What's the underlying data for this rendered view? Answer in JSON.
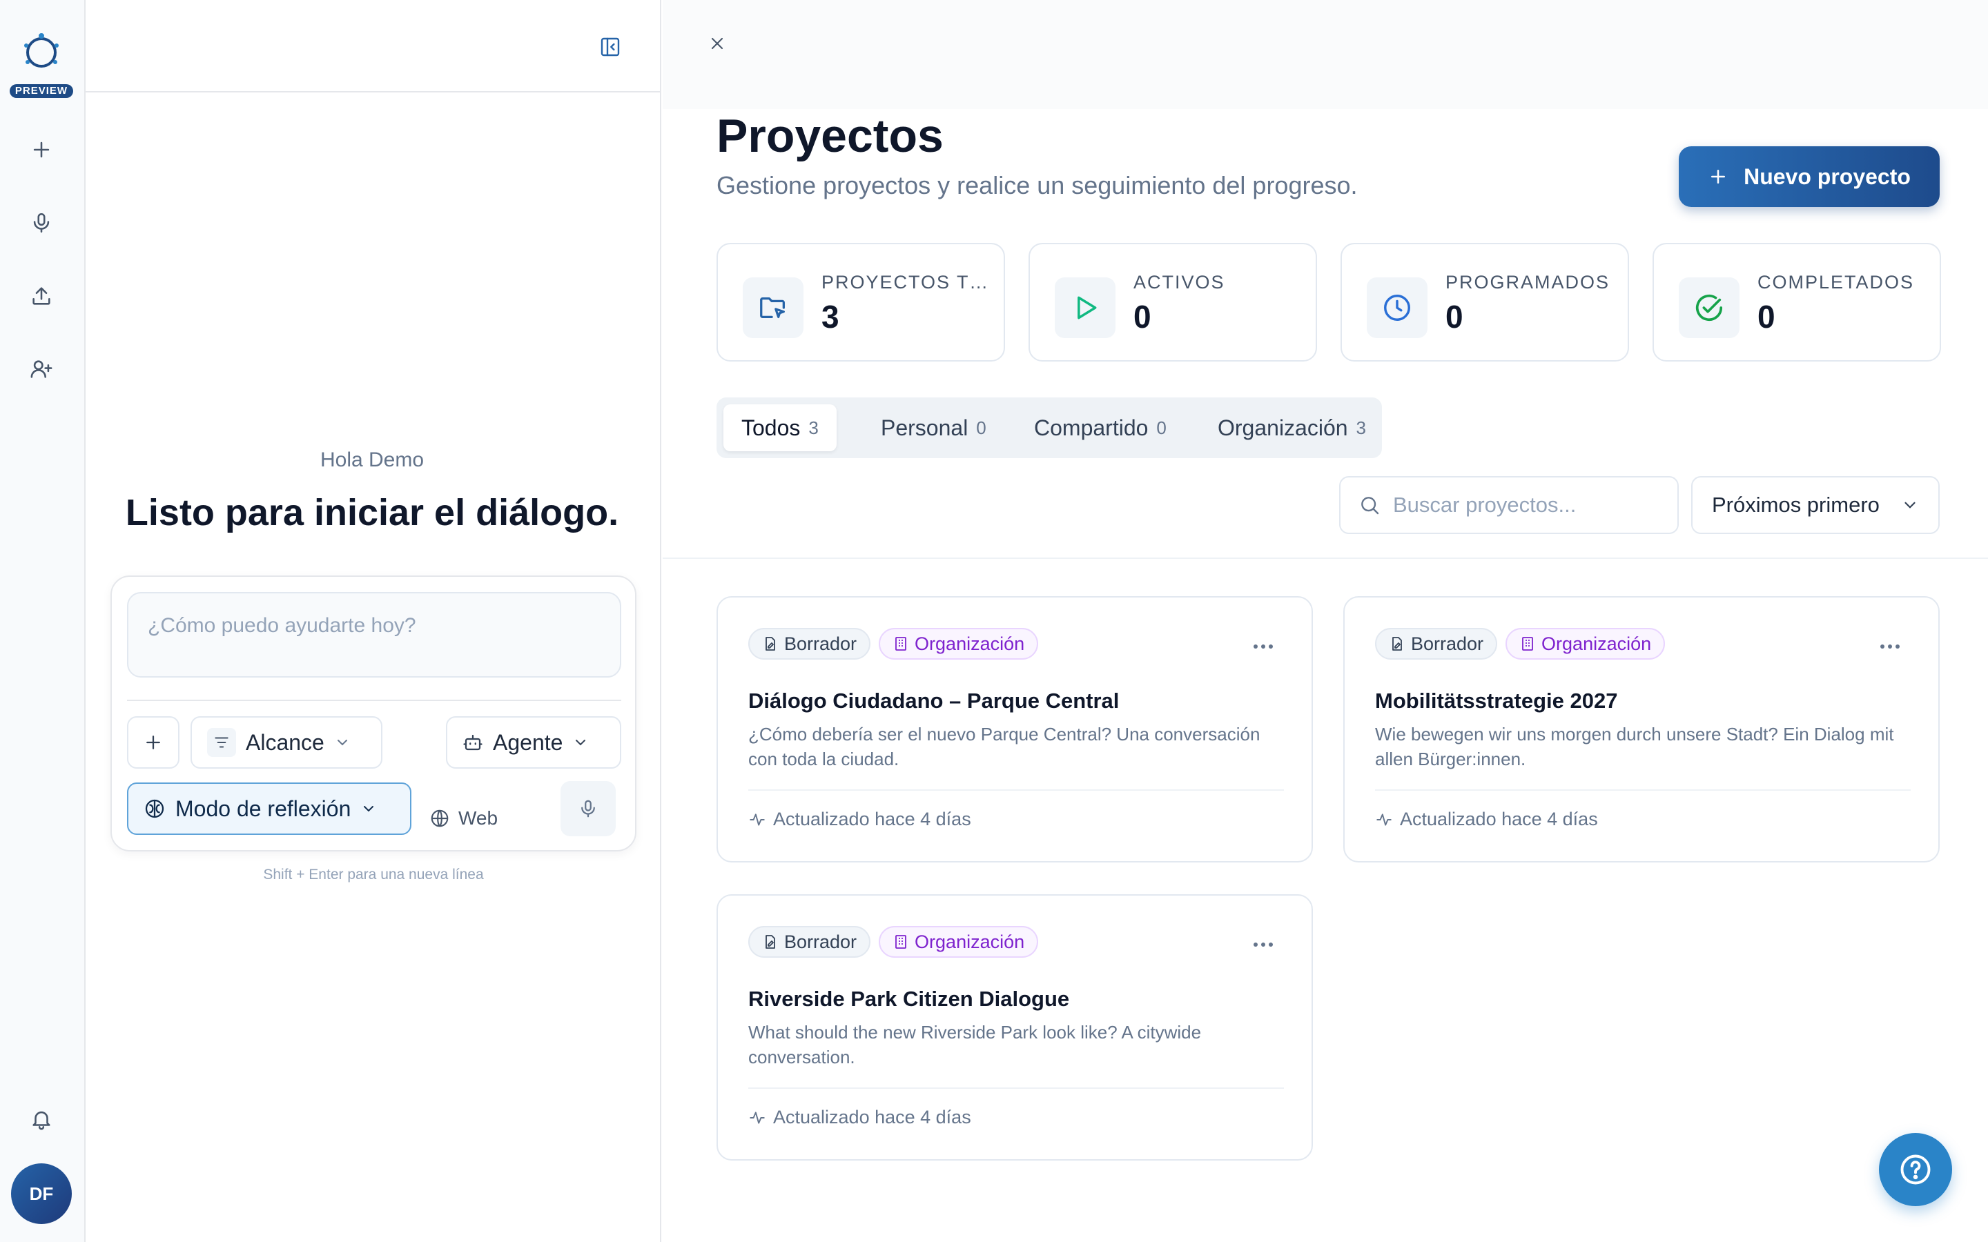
{
  "rail": {
    "badge": "PREVIEW",
    "avatar_initials": "DF",
    "icons": [
      "logo-icon",
      "plus-icon",
      "microphone-icon",
      "upload-icon",
      "user-plus-icon",
      "bell-icon"
    ]
  },
  "chat": {
    "greeting": "Hola Demo",
    "headline": "Listo para iniciar el diálogo.",
    "prompt_placeholder": "¿Cómo puedo ayudarte hoy?",
    "scope_label": "Alcance",
    "agent_label": "Agente",
    "think_label": "Modo de reflexión",
    "web_label": "Web",
    "hint": "Shift + Enter para una nueva línea"
  },
  "main": {
    "title": "Proyectos",
    "subtitle": "Gestione proyectos y realice un seguimiento del progreso.",
    "new_button": "Nuevo proyecto",
    "stats": [
      {
        "label": "PROYECTOS TOTALES",
        "value": "3",
        "color": "#2563a8"
      },
      {
        "label": "ACTIVOS",
        "value": "0",
        "color": "#10b981"
      },
      {
        "label": "PROGRAMADOS",
        "value": "0",
        "color": "#2a6fd6"
      },
      {
        "label": "COMPLETADOS",
        "value": "0",
        "color": "#16a34a"
      }
    ],
    "tabs": [
      {
        "label": "Todos",
        "count": "3"
      },
      {
        "label": "Personal",
        "count": "0"
      },
      {
        "label": "Compartido",
        "count": "0"
      },
      {
        "label": "Organización",
        "count": "3"
      }
    ],
    "search_placeholder": "Buscar proyectos...",
    "sort_label": "Próximos primero",
    "projects": [
      {
        "status": "Borrador",
        "scope": "Organización",
        "title": "Diálogo Ciudadano – Parque Central",
        "description": "¿Cómo debería ser el nuevo Parque Central? Una conversación con toda la ciudad.",
        "updated": "Actualizado hace 4 días"
      },
      {
        "status": "Borrador",
        "scope": "Organización",
        "title": "Mobilitätsstrategie 2027",
        "description": "Wie bewegen wir uns morgen durch unsere Stadt? Ein Dialog mit allen Bürger:innen.",
        "updated": "Actualizado hace 4 días"
      },
      {
        "status": "Borrador",
        "scope": "Organización",
        "title": "Riverside Park Citizen Dialogue",
        "description": "What should the new Riverside Park look like? A citywide conversation.",
        "updated": "Actualizado hace 4 días"
      }
    ]
  },
  "colors": {
    "brand": "#1e4b86",
    "accent": "#2a84c8",
    "org_badge": "#7e22ce"
  }
}
